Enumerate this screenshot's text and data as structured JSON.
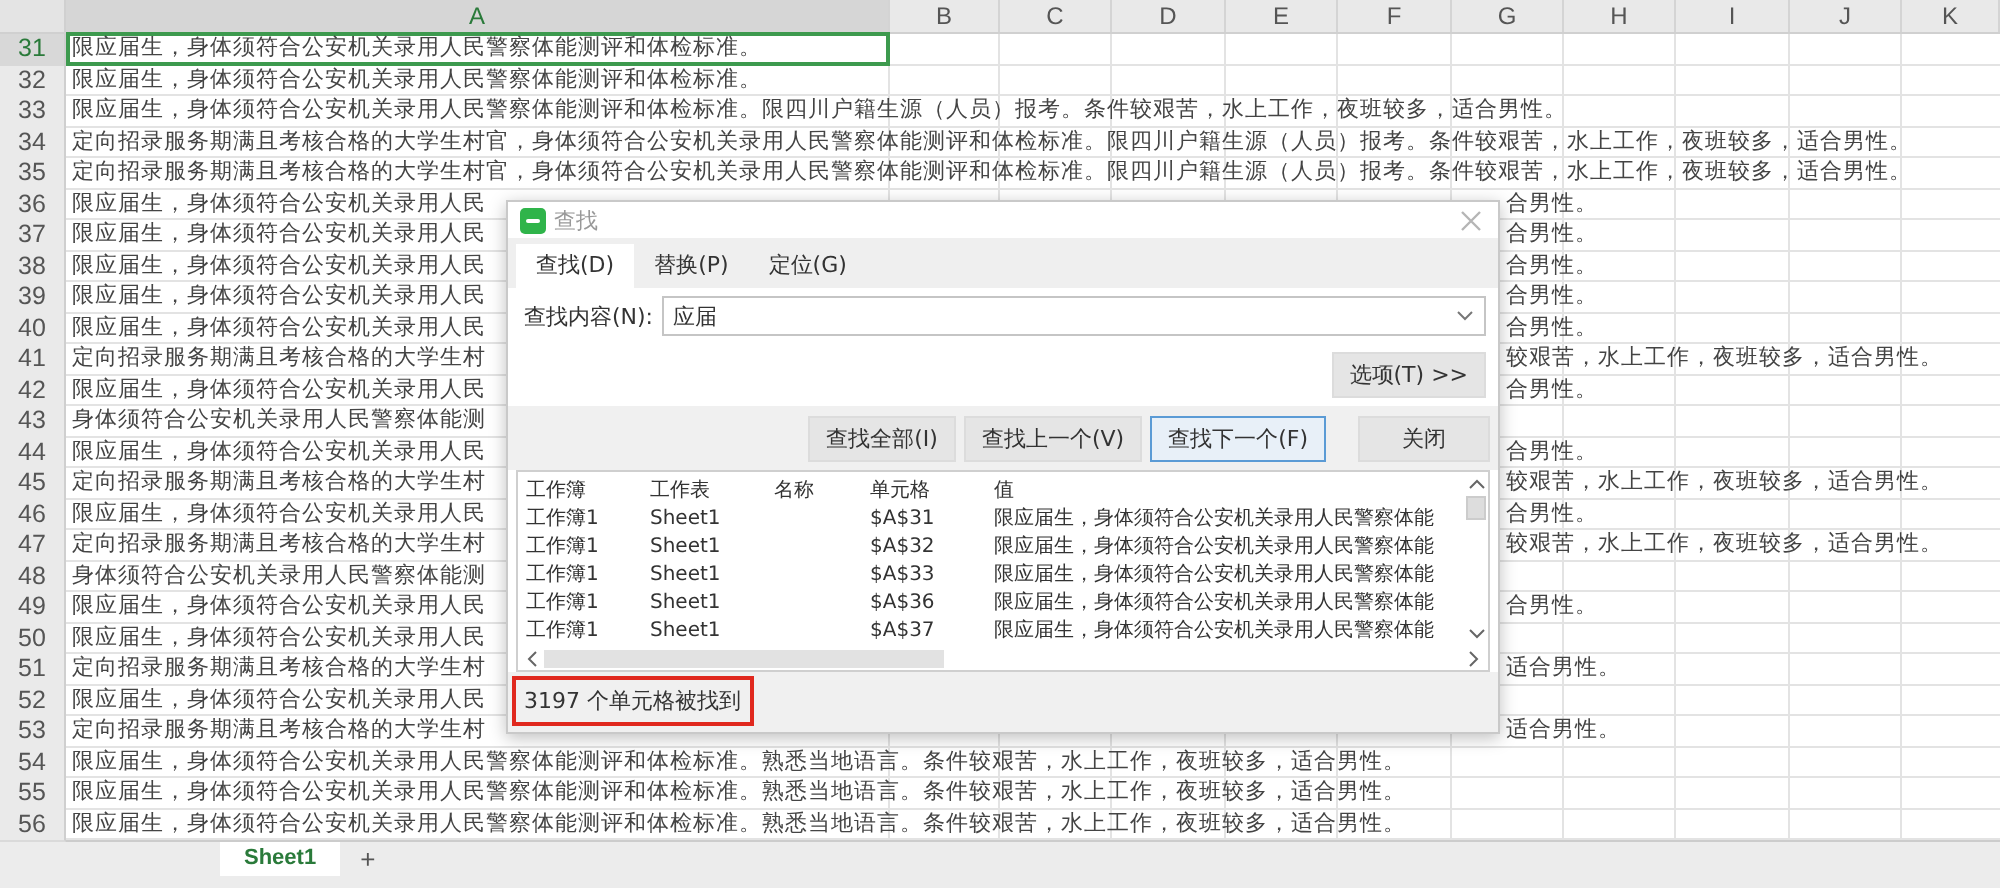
{
  "sheet": {
    "columns": [
      {
        "label": "A",
        "selected": true
      },
      {
        "label": "B",
        "selected": false
      },
      {
        "label": "C",
        "selected": false
      },
      {
        "label": "D",
        "selected": false
      },
      {
        "label": "E",
        "selected": false
      },
      {
        "label": "F",
        "selected": false
      },
      {
        "label": "G",
        "selected": false
      },
      {
        "label": "H",
        "selected": false
      },
      {
        "label": "I",
        "selected": false
      },
      {
        "label": "J",
        "selected": false
      },
      {
        "label": "K",
        "selected": false
      }
    ],
    "rows": [
      {
        "number": "31",
        "selected": true,
        "text": "限应届生，身体须符合公安机关录用人民警察体能测评和体检标准。"
      },
      {
        "number": "32",
        "selected": false,
        "text": "限应届生，身体须符合公安机关录用人民警察体能测评和体检标准。"
      },
      {
        "number": "33",
        "selected": false,
        "text": "限应届生，身体须符合公安机关录用人民警察体能测评和体检标准。限四川户籍生源（人员）报考。条件较艰苦，水上工作，夜班较多，适合男性。"
      },
      {
        "number": "34",
        "selected": false,
        "text": "定向招录服务期满且考核合格的大学生村官，身体须符合公安机关录用人民警察体能测评和体检标准。限四川户籍生源（人员）报考。条件较艰苦，水上工作，夜班较多，适合男性。"
      },
      {
        "number": "35",
        "selected": false,
        "text": "定向招录服务期满且考核合格的大学生村官，身体须符合公安机关录用人民警察体能测评和体检标准。限四川户籍生源（人员）报考。条件较艰苦，水上工作，夜班较多，适合男性。"
      },
      {
        "number": "36",
        "selected": false,
        "text": "限应届生，身体须符合公安机关录用人民",
        "text_right": "合男性。"
      },
      {
        "number": "37",
        "selected": false,
        "text": "限应届生，身体须符合公安机关录用人民",
        "text_right": "合男性。"
      },
      {
        "number": "38",
        "selected": false,
        "text": "限应届生，身体须符合公安机关录用人民",
        "text_right": "合男性。"
      },
      {
        "number": "39",
        "selected": false,
        "text": "限应届生，身体须符合公安机关录用人民",
        "text_right": "合男性。"
      },
      {
        "number": "40",
        "selected": false,
        "text": "限应届生，身体须符合公安机关录用人民",
        "text_right": "合男性。"
      },
      {
        "number": "41",
        "selected": false,
        "text": "定向招录服务期满且考核合格的大学生村",
        "text_right": "较艰苦，水上工作，夜班较多，适合男性。"
      },
      {
        "number": "42",
        "selected": false,
        "text": "限应届生，身体须符合公安机关录用人民",
        "text_right": "合男性。"
      },
      {
        "number": "43",
        "selected": false,
        "text": "身体须符合公安机关录用人民警察体能测"
      },
      {
        "number": "44",
        "selected": false,
        "text": "限应届生，身体须符合公安机关录用人民",
        "text_right": "合男性。"
      },
      {
        "number": "45",
        "selected": false,
        "text": "定向招录服务期满且考核合格的大学生村",
        "text_right": "较艰苦，水上工作，夜班较多，适合男性。"
      },
      {
        "number": "46",
        "selected": false,
        "text": "限应届生，身体须符合公安机关录用人民",
        "text_right": "合男性。"
      },
      {
        "number": "47",
        "selected": false,
        "text": "定向招录服务期满且考核合格的大学生村",
        "text_right": "较艰苦，水上工作，夜班较多，适合男性。"
      },
      {
        "number": "48",
        "selected": false,
        "text": "身体须符合公安机关录用人民警察体能测"
      },
      {
        "number": "49",
        "selected": false,
        "text": "限应届生，身体须符合公安机关录用人民",
        "text_right": "合男性。"
      },
      {
        "number": "50",
        "selected": false,
        "text": "限应届生，身体须符合公安机关录用人民"
      },
      {
        "number": "51",
        "selected": false,
        "text": "定向招录服务期满且考核合格的大学生村",
        "text_right": "适合男性。"
      },
      {
        "number": "52",
        "selected": false,
        "text": "限应届生，身体须符合公安机关录用人民"
      },
      {
        "number": "53",
        "selected": false,
        "text": "定向招录服务期满且考核合格的大学生村",
        "text_right": "适合男性。"
      },
      {
        "number": "54",
        "selected": false,
        "text": "限应届生，身体须符合公安机关录用人民警察体能测评和体检标准。熟悉当地语言。条件较艰苦，水上工作，夜班较多，适合男性。"
      },
      {
        "number": "55",
        "selected": false,
        "text": "限应届生，身体须符合公安机关录用人民警察体能测评和体检标准。熟悉当地语言。条件较艰苦，水上工作，夜班较多，适合男性。"
      },
      {
        "number": "56",
        "selected": false,
        "text": "限应届生，身体须符合公安机关录用人民警察体能测评和体检标准。熟悉当地语言。条件较艰苦，水上工作，夜班较多，适合男性。"
      }
    ]
  },
  "sheet_tabs": [
    {
      "label": "Sheet1",
      "selected": true
    }
  ],
  "add_sheet": "+",
  "dialog": {
    "title": "查找",
    "tabs": [
      {
        "label": "查找(D)",
        "selected": true
      },
      {
        "label": "替换(P)",
        "selected": false
      },
      {
        "label": "定位(G)",
        "selected": false
      }
    ],
    "find_label": "查找内容(N):",
    "find_value": "应届",
    "options_button": "选项(T) >>",
    "buttons": [
      {
        "label": "查找全部(I)",
        "focused": false
      },
      {
        "label": "查找上一个(V)",
        "focused": false
      },
      {
        "label": "查找下一个(F)",
        "focused": true
      },
      {
        "label": "关闭",
        "focused": false
      }
    ],
    "results": {
      "columns": [
        "工作簿",
        "工作表",
        "名称",
        "单元格",
        "值"
      ],
      "rows": [
        [
          "工作簿1",
          "Sheet1",
          "",
          "$A$31",
          "限应届生，身体须符合公安机关录用人民警察体能"
        ],
        [
          "工作簿1",
          "Sheet1",
          "",
          "$A$32",
          "限应届生，身体须符合公安机关录用人民警察体能"
        ],
        [
          "工作簿1",
          "Sheet1",
          "",
          "$A$33",
          "限应届生，身体须符合公安机关录用人民警察体能"
        ],
        [
          "工作簿1",
          "Sheet1",
          "",
          "$A$36",
          "限应届生，身体须符合公安机关录用人民警察体能"
        ],
        [
          "工作簿1",
          "Sheet1",
          "",
          "$A$37",
          "限应届生，身体须符合公安机关录用人民警察体能"
        ]
      ]
    },
    "status": "3197 个单元格被找到",
    "status_highlighted": true
  }
}
